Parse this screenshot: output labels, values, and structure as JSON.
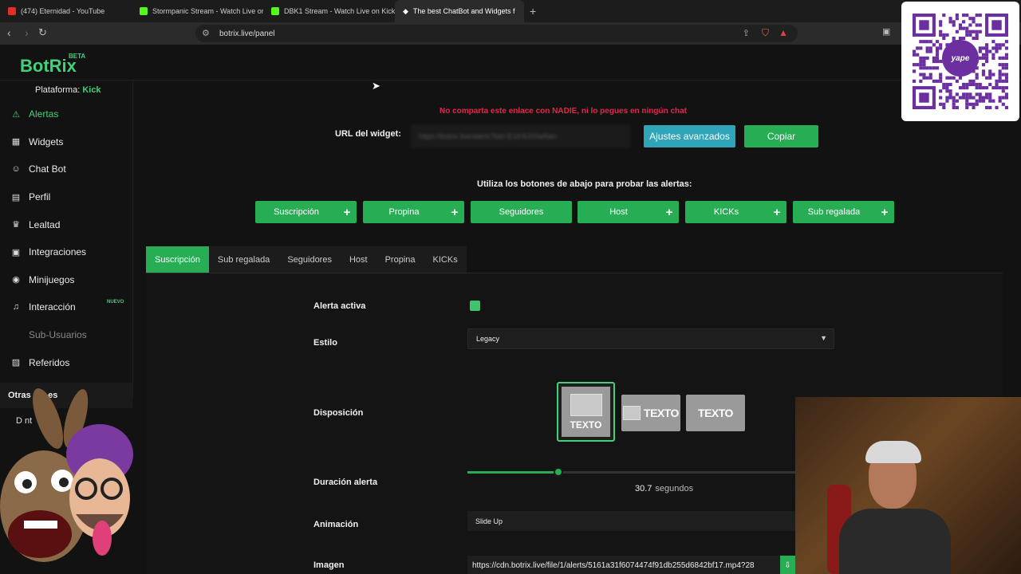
{
  "browser": {
    "tabs": [
      {
        "title": "(474) Eternidad - YouTube",
        "color": "#e52d27"
      },
      {
        "title": "Stormpanic Stream - Watch Live on K",
        "color": "#53fc18"
      },
      {
        "title": "DBK1 Stream - Watch Live on Kick",
        "color": "#53fc18"
      },
      {
        "title": "The best ChatBot and Widgets f",
        "color": "#ffffff"
      }
    ],
    "url": "botrix.live/panel"
  },
  "app": {
    "logo": "BotRix",
    "beta": "BETA",
    "platform_label": "Plataforma:",
    "platform_value": "Kick"
  },
  "sidebar": {
    "items": [
      {
        "label": "Alertas",
        "icon": "⚠"
      },
      {
        "label": "Widgets",
        "icon": "▦"
      },
      {
        "label": "Chat Bot",
        "icon": "☺"
      },
      {
        "label": "Perfil",
        "icon": "▤"
      },
      {
        "label": "Lealtad",
        "icon": "♛"
      },
      {
        "label": "Integraciones",
        "icon": "▣"
      },
      {
        "label": "Minijuegos",
        "icon": "◉"
      },
      {
        "label": "Interacción",
        "icon": "♫",
        "badge": "NUEVO"
      },
      {
        "label": "Sub-Usuarios",
        "icon": ""
      },
      {
        "label": "Referidos",
        "icon": "▨"
      }
    ],
    "other_section": "Otras Op      es",
    "other_sub": "D         nt"
  },
  "widget": {
    "warning": "No comparta este enlace con NADIE, ni lo pegues en ningún chat",
    "url_label": "URL del widget:",
    "url_value": "https://botrix.live/alerts?bid=E1KNJ00wNan",
    "advanced_button": "Ajustes avanzados",
    "copy_button": "Copiar"
  },
  "test": {
    "label": "Utiliza los botones de abajo para probar las alertas:",
    "buttons": [
      "Suscripción",
      "Propina",
      "Seguidores",
      "Host",
      "KICKs",
      "Sub regalada"
    ]
  },
  "tabs": [
    "Suscripción",
    "Sub regalada",
    "Seguidores",
    "Host",
    "Propina",
    "KICKs"
  ],
  "form": {
    "active_label": "Alerta activa",
    "style_label": "Estilo",
    "style_value": "Legacy",
    "layout_label": "Disposición",
    "layout_text": "TEXTO",
    "duration_label": "Duración alerta",
    "duration_value": "30.7",
    "duration_unit": "segundos",
    "duration_fraction": 0.278,
    "animation_label": "Animación",
    "animation_value": "Slide Up",
    "image_label": "Imagen",
    "image_value": "https://cdn.botrix.live/file/1/alerts/5161a31f6074474f91db255d6842bf17.mp4?28"
  },
  "overlay": {
    "qr_brand": "yape"
  }
}
